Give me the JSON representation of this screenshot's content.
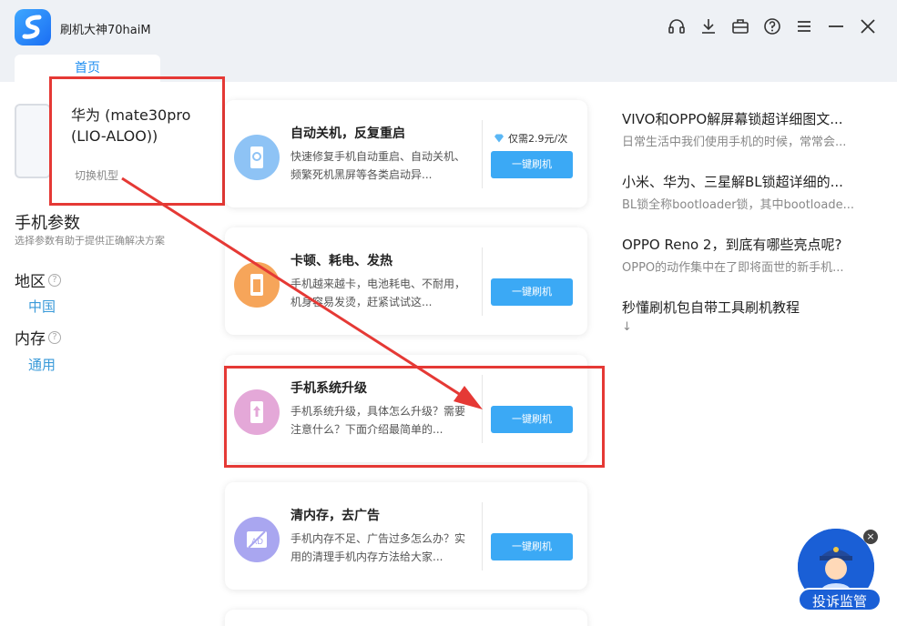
{
  "app": {
    "title": "刷机大神70haiM"
  },
  "tabs": [
    {
      "label": "首页"
    }
  ],
  "device": {
    "name": "华为 (mate30pro (LIO-ALOO))",
    "switch_label": "切换机型"
  },
  "params": {
    "title": "手机参数",
    "subtitle": "选择参数有助于提供正确解决方案",
    "region": {
      "label": "地区",
      "value": "中国"
    },
    "memory": {
      "label": "内存",
      "value": "通用"
    }
  },
  "cards": [
    {
      "title": "自动关机，反复重启",
      "desc": "快速修复手机自动重启、自动关机、频繁死机黑屏等各类启动异...",
      "button": "一键刷机",
      "price": "仅需2.9元/次",
      "color": "#8ec3f5",
      "icon": "phone-restart-icon"
    },
    {
      "title": "卡顿、耗电、发热",
      "desc": "手机越来越卡，电池耗电、不耐用，机身容易发烫，赶紧试试这...",
      "button": "一键刷机",
      "color": "#f6a55a",
      "icon": "battery-phone-icon"
    },
    {
      "title": "手机系统升级",
      "desc": "手机系统升级，具体怎么升级？需要注意什么？下面介绍最简单的...",
      "button": "一键刷机",
      "color": "#e4a8d8",
      "icon": "upgrade-phone-icon"
    },
    {
      "title": "清内存，去广告",
      "desc": "手机内存不足、广告过多怎么办？实用的清理手机内存方法给大家...",
      "button": "一键刷机",
      "color": "#a9a6f0",
      "icon": "no-ad-icon"
    }
  ],
  "articles": [
    {
      "title": "VIVO和OPPO解屏幕锁超详细图文...",
      "desc": "日常生活中我们使用手机的时候，常常会..."
    },
    {
      "title": "小米、华为、三星解BL锁超详细的...",
      "desc": "BL锁全称bootloader锁，其中bootloade..."
    },
    {
      "title": "OPPO Reno 2，到底有哪些亮点呢?",
      "desc": "OPPO的动作集中在了即将面世的新手机..."
    },
    {
      "title": "秒懂刷机包自带工具刷机教程",
      "desc": "↓"
    }
  ],
  "complaint": {
    "label": "投诉监管",
    "close": "×"
  },
  "colors": {
    "accent": "#1f8ef1",
    "button": "#3ba9f5",
    "highlight": "#e53935"
  }
}
